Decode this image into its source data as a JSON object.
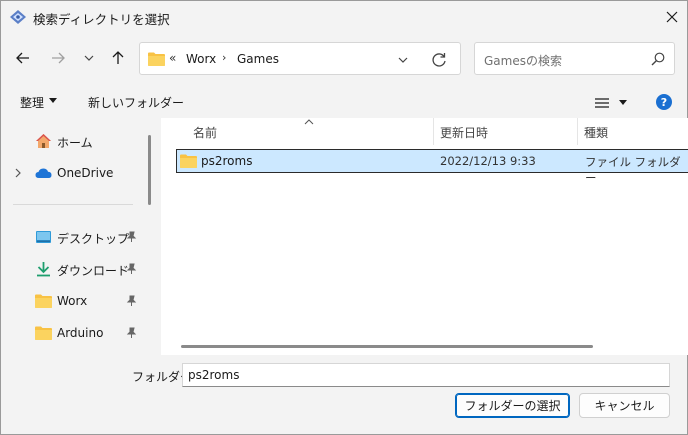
{
  "window": {
    "title": "検索ディレクトリを選択"
  },
  "address": {
    "overflow": "«",
    "crumbs": [
      "Worx",
      "Games"
    ],
    "separator": "›"
  },
  "search": {
    "placeholder": "Gamesの検索"
  },
  "toolbar": {
    "organize_label": "整理",
    "new_folder_label": "新しいフォルダー",
    "help_label": "?"
  },
  "nav": {
    "items": [
      {
        "label": "ホーム",
        "icon": "home-icon"
      },
      {
        "label": "OneDrive",
        "icon": "cloud-icon"
      },
      {
        "label": "デスクトップ",
        "icon": "desktop-icon",
        "pinned": true
      },
      {
        "label": "ダウンロード",
        "icon": "download-icon",
        "pinned": true
      },
      {
        "label": "Worx",
        "icon": "folder-icon",
        "pinned": true
      },
      {
        "label": "Arduino",
        "icon": "folder-icon",
        "pinned": true
      }
    ]
  },
  "files": {
    "columns": {
      "name": "名前",
      "date": "更新日時",
      "type": "種類"
    },
    "rows": [
      {
        "name": "ps2roms",
        "date": "2022/12/13 9:33",
        "type": "ファイル フォルダー",
        "selected": true
      }
    ]
  },
  "footer": {
    "folder_label": "フォルダー:",
    "folder_value": "ps2roms",
    "select_button": "フォルダーの選択",
    "cancel_button": "キャンセル"
  },
  "colors": {
    "accent": "#0067c0",
    "selection": "#cce8ff",
    "folder": "#f8c244"
  }
}
